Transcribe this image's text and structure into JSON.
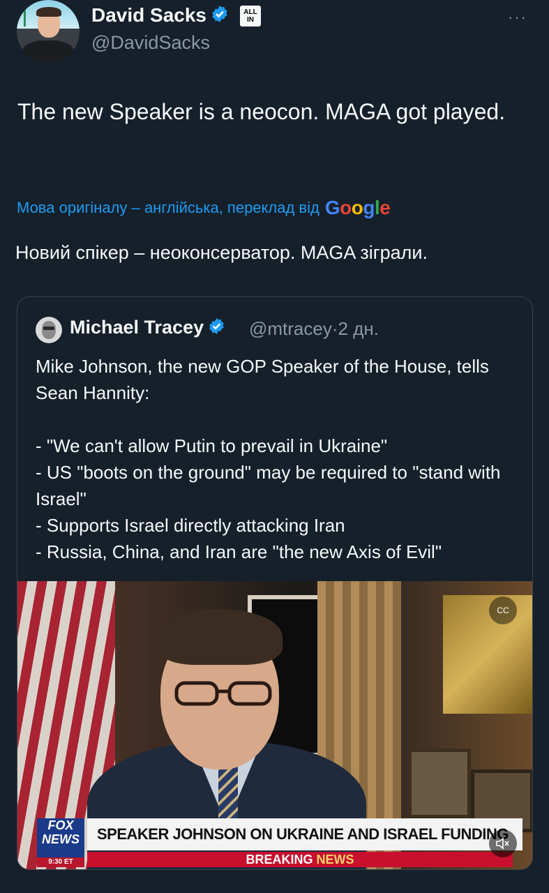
{
  "author": {
    "name": "David Sacks",
    "handle": "@DavidSacks",
    "badge_label_1": "ALL",
    "badge_label_2": "IN",
    "more_label": "···"
  },
  "tweet": {
    "text": "The new Speaker is a neocon. MAGA got played.",
    "translation_notice": "Мова оригіналу – англійська, переклад від",
    "translation_provider": "Google",
    "translated_text": "Новий спікер – неоконсерватор. MAGA зіграли."
  },
  "quoted": {
    "name": "Michael Tracey",
    "handle": "@mtracey",
    "separator": "·",
    "time": "2 дн.",
    "text": "Mike Johnson, the new GOP Speaker of the House, tells Sean Hannity:\n\n- \"We can't allow Putin to prevail in Ukraine\"\n- US \"boots on the ground\" may be required to \"stand with Israel\"\n- Supports Israel directly attacking Iran\n- Russia, China, and Iran are \"the new Axis of Evil\"",
    "media": {
      "network_line1": "FOX",
      "network_line2": "NEWS",
      "network_time": "9:30 ET",
      "chyron": "SPEAKER JOHNSON ON UKRAINE AND ISRAEL FUNDING",
      "breaking_1": "BREAKING",
      "breaking_2": "NEWS",
      "cc_label": "CC"
    }
  },
  "colors": {
    "background": "#15202b",
    "link": "#1d9bf0",
    "verified": "#1d9bf0",
    "muted": "#8b98a5"
  }
}
